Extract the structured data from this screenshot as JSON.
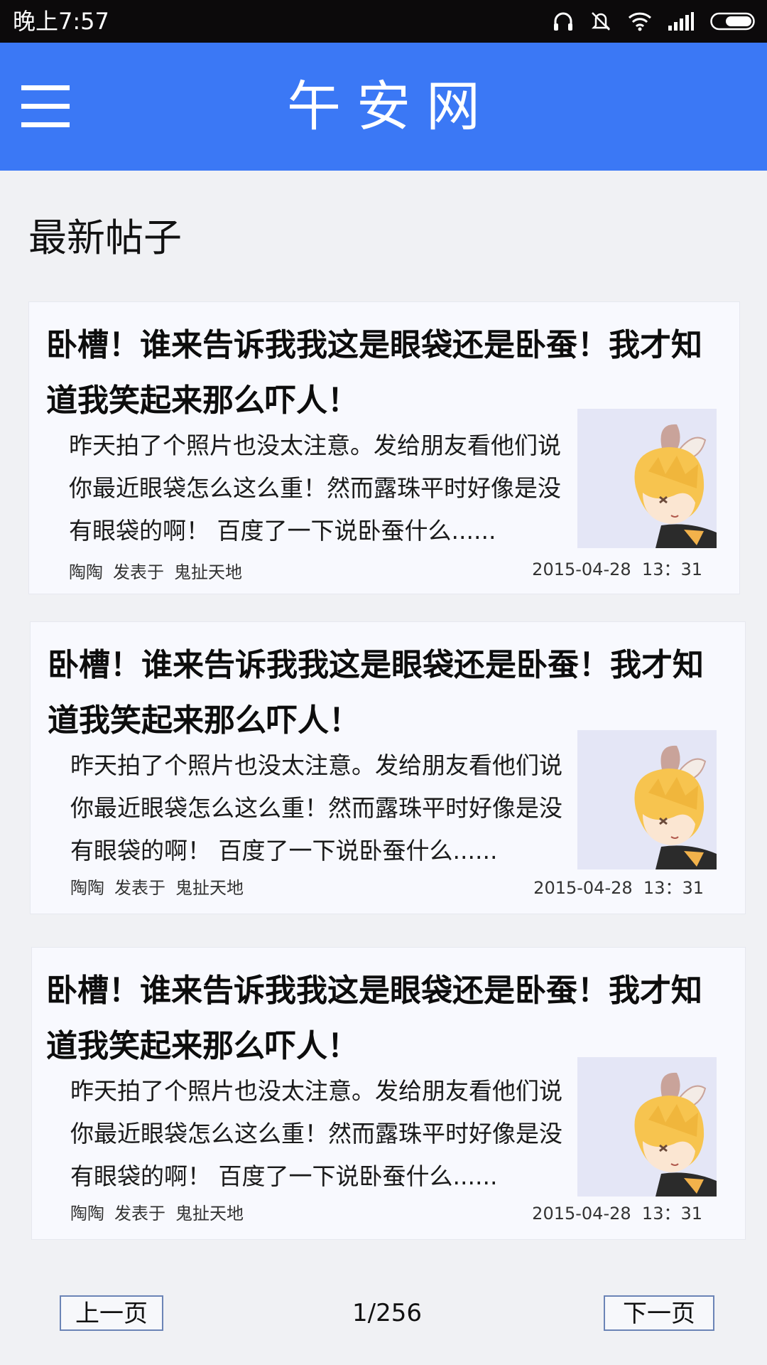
{
  "status_bar": {
    "time": "晚上7:57",
    "icons": [
      "headphones-icon",
      "mute-icon",
      "wifi-icon",
      "signal-icon",
      "battery-icon"
    ]
  },
  "app_bar": {
    "title": "午安网",
    "menu_icon": "hamburger-menu-icon",
    "background_color": "#3b78f5"
  },
  "section": {
    "title": "最新帖子"
  },
  "posts": [
    {
      "title": "卧槽！谁来告诉我我这是眼袋还是卧蚕！我才知道我笑起来那么吓人！",
      "excerpt": "昨天拍了个照片也没太注意。发给朋友看他们说你最近眼袋怎么这么重！然而露珠平时好像是没有眼袋的啊！ 百度了一下说卧蚕什么......",
      "author": "陶陶",
      "posted_in_label": "发表于",
      "board": "鬼扯天地",
      "date": "2015-04-28",
      "time": "13：31"
    },
    {
      "title": "卧槽！谁来告诉我我这是眼袋还是卧蚕！我才知道我笑起来那么吓人！",
      "excerpt": "昨天拍了个照片也没太注意。发给朋友看他们说你最近眼袋怎么这么重！然而露珠平时好像是没有眼袋的啊！ 百度了一下说卧蚕什么......",
      "author": "陶陶",
      "posted_in_label": "发表于",
      "board": "鬼扯天地",
      "date": "2015-04-28",
      "time": "13：31"
    },
    {
      "title": "卧槽！谁来告诉我我这是眼袋还是卧蚕！我才知道我笑起来那么吓人！",
      "excerpt": "昨天拍了个照片也没太注意。发给朋友看他们说你最近眼袋怎么这么重！然而露珠平时好像是没有眼袋的啊！ 百度了一下说卧蚕什么......",
      "author": "陶陶",
      "posted_in_label": "发表于",
      "board": "鬼扯天地",
      "date": "2015-04-28",
      "time": "13：31"
    }
  ],
  "pagination": {
    "prev_label": "上一页",
    "next_label": "下一页",
    "current": "1/256"
  }
}
